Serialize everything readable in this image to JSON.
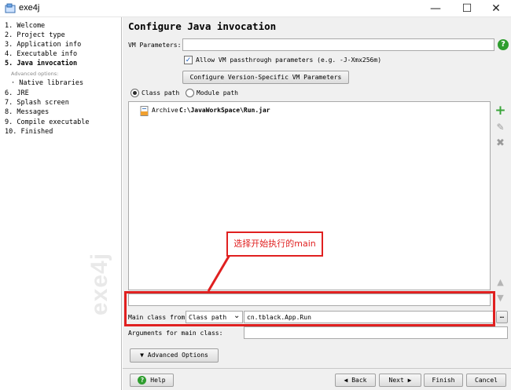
{
  "window": {
    "title": "exe4j",
    "minimize_glyph": "—",
    "maximize_glyph": "☐",
    "close_glyph": "✕"
  },
  "sidebar": {
    "items": [
      {
        "label": "1.  Welcome"
      },
      {
        "label": "2.  Project type"
      },
      {
        "label": "3.  Application info"
      },
      {
        "label": "4.  Executable info"
      },
      {
        "label": "5.  Java invocation"
      },
      {
        "label": "Advanced options:"
      },
      {
        "label": "· Native libraries"
      },
      {
        "label": "6.  JRE"
      },
      {
        "label": "7.  Splash screen"
      },
      {
        "label": "8.  Messages"
      },
      {
        "label": "9.  Compile executable"
      },
      {
        "label": "10.  Finished"
      }
    ],
    "watermark": "exe4j"
  },
  "main": {
    "heading": "Configure Java invocation",
    "vm_parameters_label": "VM Parameters:",
    "vm_parameters_value": "",
    "help_glyph": "?",
    "allow_passthrough_label": "Allow VM passthrough parameters (e.g. -J-Xmx256m)",
    "allow_passthrough_checked": true,
    "check_glyph": "✓",
    "configure_version_button": "Configure Version-Specific VM Parameters",
    "class_path_radio": "Class path",
    "module_path_radio": "Module path",
    "classpath_entries": [
      {
        "type": "Archive",
        "path": "C:\\JavaWorkSpace\\Run.jar"
      }
    ],
    "side_buttons": {
      "add": "+",
      "edit": "✎",
      "remove": "✖",
      "up": "▲",
      "down": "▼"
    },
    "callout_text": "选择开始执行的main",
    "main_class_from_label": "Main class from",
    "main_class_source": "Class path",
    "dropdown_glyph": "⌄",
    "main_class_value": "cn.tblack.App.Run",
    "browse_glyph": "…",
    "arguments_label": "Arguments for main class:",
    "arguments_value": "",
    "advanced_options_button": "Advanced Options"
  },
  "footer": {
    "help_button": "Help",
    "back_button": "Back",
    "next_button": "Next",
    "finish_button": "Finish",
    "cancel_button": "Cancel"
  },
  "colors": {
    "accent_red": "#e02020",
    "help_green": "#2e9d2e",
    "add_green": "#3aa53a"
  }
}
